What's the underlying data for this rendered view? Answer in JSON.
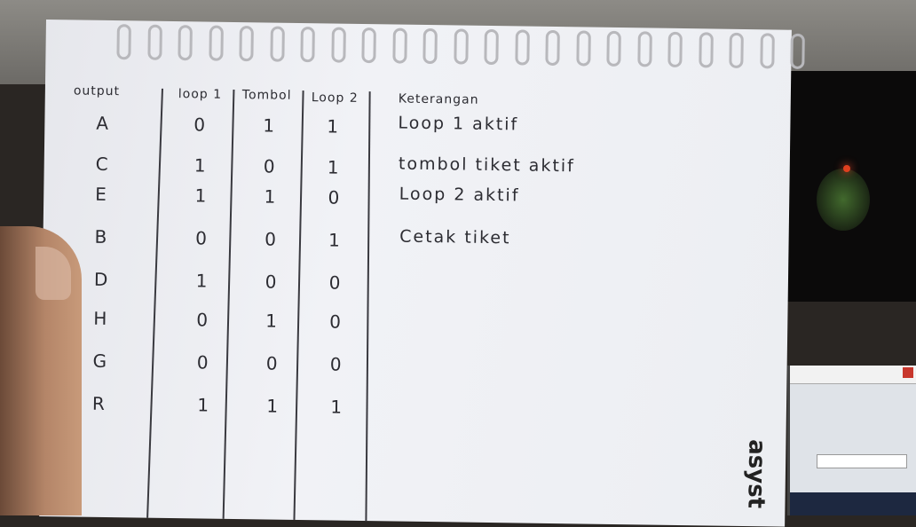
{
  "headers": {
    "output": "output",
    "loop1": "loop 1",
    "tombol": "Tombol",
    "loop2": "Loop 2",
    "keterangan": "Keterangan"
  },
  "rows": [
    {
      "output": "A",
      "loop1": "0",
      "tombol": "1",
      "loop2": "1",
      "note": "Loop 1 aktif"
    },
    {
      "output": "C",
      "loop1": "1",
      "tombol": "0",
      "loop2": "1",
      "note": "tombol tiket aktif"
    },
    {
      "output": "E",
      "loop1": "1",
      "tombol": "1",
      "loop2": "0",
      "note": "Loop 2 aktif"
    },
    {
      "output": "B",
      "loop1": "0",
      "tombol": "0",
      "loop2": "1",
      "note": "Cetak tiket"
    },
    {
      "output": "D",
      "loop1": "1",
      "tombol": "0",
      "loop2": "0",
      "note": ""
    },
    {
      "output": "H",
      "loop1": "0",
      "tombol": "1",
      "loop2": "0",
      "note": ""
    },
    {
      "output": "G",
      "loop1": "0",
      "tombol": "0",
      "loop2": "0",
      "note": ""
    },
    {
      "output": "R",
      "loop1": "1",
      "tombol": "1",
      "loop2": "1",
      "note": ""
    }
  ],
  "brand": "asyst",
  "colors": {
    "ink": "#2c2c32",
    "paper": "#eceef2"
  }
}
